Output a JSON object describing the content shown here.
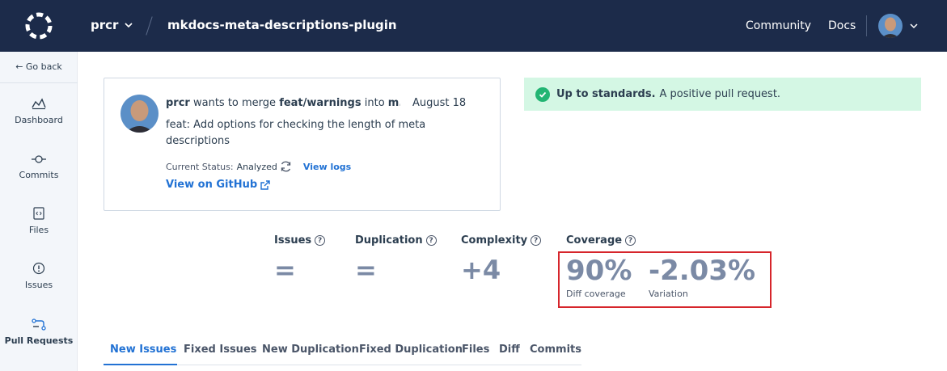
{
  "topbar": {
    "org": "prcr",
    "repo": "mkdocs-meta-descriptions-plugin",
    "community": "Community",
    "docs": "Docs"
  },
  "sidebar": {
    "go_back": "← Go back",
    "items": [
      {
        "label": "Dashboard",
        "icon": "dashboard-icon"
      },
      {
        "label": "Commits",
        "icon": "commit-icon"
      },
      {
        "label": "Files",
        "icon": "file-code-icon"
      },
      {
        "label": "Issues",
        "icon": "issue-icon"
      },
      {
        "label": "Pull Requests",
        "icon": "pull-request-icon",
        "active": true
      }
    ]
  },
  "pr": {
    "author": "prcr",
    "merge_text": "wants to merge",
    "source_branch": "feat/warnings",
    "into_text": "into",
    "target_branch": "m...",
    "date": "August 18",
    "description": "feat: Add options for checking the length of meta descriptions",
    "status_label": "Current Status:",
    "status_value": "Analyzed",
    "view_logs": "View logs",
    "view_github": "View on GitHub"
  },
  "banner": {
    "title": "Up to standards.",
    "text": "A positive pull request.",
    "color": "#22b573"
  },
  "metrics": {
    "issues": {
      "title": "Issues",
      "value": "="
    },
    "duplication": {
      "title": "Duplication",
      "value": "="
    },
    "complexity": {
      "title": "Complexity",
      "value": "+4"
    },
    "coverage": {
      "title": "Coverage",
      "diff_value": "90%",
      "diff_label": "Diff coverage",
      "variation_value": "-2.03%",
      "variation_label": "Variation"
    }
  },
  "tabs": [
    "New Issues",
    "Fixed Issues",
    "New Duplication",
    "Fixed Duplication",
    "Files",
    "Diff",
    "Commits"
  ],
  "colors": {
    "topbar": "#1c2b4a",
    "accent": "#2272d4",
    "highlight_box": "#d6252b"
  }
}
